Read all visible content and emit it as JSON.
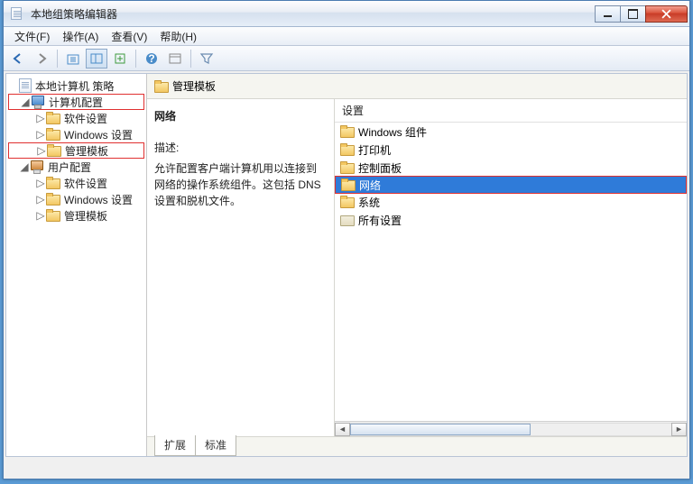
{
  "window": {
    "title": "本地组策略编辑器"
  },
  "menubar": [
    "文件(F)",
    "操作(A)",
    "查看(V)",
    "帮助(H)"
  ],
  "tree": {
    "root": "本地计算机 策略",
    "computer_config": "计算机配置",
    "cc_children": [
      "软件设置",
      "Windows 设置",
      "管理模板"
    ],
    "user_config": "用户配置",
    "uc_children": [
      "软件设置",
      "Windows 设置",
      "管理模板"
    ]
  },
  "header": {
    "title": "管理模板"
  },
  "desc": {
    "heading": "网络",
    "label": "描述:",
    "text": "允许配置客户端计算机用以连接到网络的操作系统组件。这包括 DNS 设置和脱机文件。"
  },
  "list": {
    "column": "设置",
    "items": [
      {
        "label": "Windows 组件",
        "icon": "folder",
        "selected": false
      },
      {
        "label": "打印机",
        "icon": "folder",
        "selected": false
      },
      {
        "label": "控制面板",
        "icon": "folder",
        "selected": false
      },
      {
        "label": "网络",
        "icon": "folder",
        "selected": true,
        "highlight": true
      },
      {
        "label": "系统",
        "icon": "folder",
        "selected": false
      },
      {
        "label": "所有设置",
        "icon": "allset",
        "selected": false
      }
    ]
  },
  "tabs": {
    "extended": "扩展",
    "standard": "标准"
  }
}
